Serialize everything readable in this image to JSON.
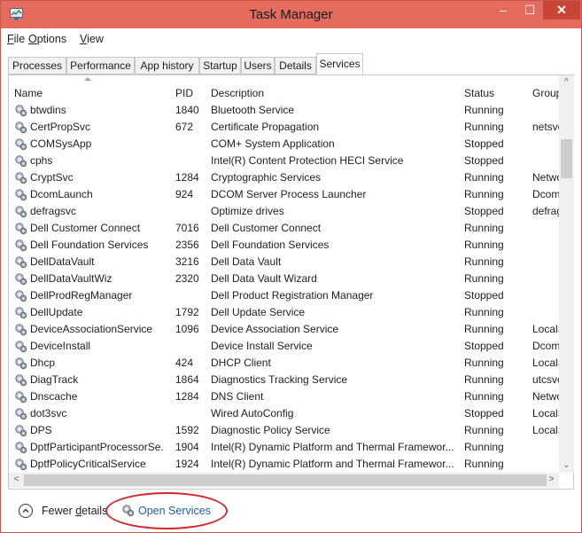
{
  "window": {
    "title": "Task Manager",
    "min_glyph": "–",
    "max_glyph": "☐",
    "close_glyph": "✕"
  },
  "menu": [
    {
      "hotkey": "F",
      "rest": "ile"
    },
    {
      "hotkey": "O",
      "rest": "ptions"
    },
    {
      "hotkey": "V",
      "rest": "iew"
    }
  ],
  "tabs": [
    "Processes",
    "Performance",
    "App history",
    "Startup",
    "Users",
    "Details",
    "Services"
  ],
  "active_tab": "Services",
  "columns": {
    "name": "Name",
    "pid": "PID",
    "description": "Description",
    "status": "Status",
    "group": "Group"
  },
  "services": [
    {
      "name": "btwdins",
      "pid": "1840",
      "description": "Bluetooth Service",
      "status": "Running",
      "group": ""
    },
    {
      "name": "CertPropSvc",
      "pid": "672",
      "description": "Certificate Propagation",
      "status": "Running",
      "group": "netsvcs"
    },
    {
      "name": "COMSysApp",
      "pid": "",
      "description": "COM+ System Application",
      "status": "Stopped",
      "group": ""
    },
    {
      "name": "cphs",
      "pid": "",
      "description": "Intel(R) Content Protection HECI Service",
      "status": "Stopped",
      "group": ""
    },
    {
      "name": "CryptSvc",
      "pid": "1284",
      "description": "Cryptographic Services",
      "status": "Running",
      "group": "Networl"
    },
    {
      "name": "DcomLaunch",
      "pid": "924",
      "description": "DCOM Server Process Launcher",
      "status": "Running",
      "group": "DcomLa"
    },
    {
      "name": "defragsvc",
      "pid": "",
      "description": "Optimize drives",
      "status": "Stopped",
      "group": "defrags"
    },
    {
      "name": "Dell Customer Connect",
      "pid": "7016",
      "description": "Dell Customer Connect",
      "status": "Running",
      "group": ""
    },
    {
      "name": "Dell Foundation Services",
      "pid": "2356",
      "description": "Dell Foundation Services",
      "status": "Running",
      "group": ""
    },
    {
      "name": "DellDataVault",
      "pid": "3216",
      "description": "Dell Data Vault",
      "status": "Running",
      "group": ""
    },
    {
      "name": "DellDataVaultWiz",
      "pid": "2320",
      "description": "Dell Data Vault Wizard",
      "status": "Running",
      "group": ""
    },
    {
      "name": "DellProdRegManager",
      "pid": "",
      "description": "Dell Product Registration Manager",
      "status": "Stopped",
      "group": ""
    },
    {
      "name": "DellUpdate",
      "pid": "1792",
      "description": "Dell Update Service",
      "status": "Running",
      "group": ""
    },
    {
      "name": "DeviceAssociationService",
      "pid": "1096",
      "description": "Device Association Service",
      "status": "Running",
      "group": "LocalSy:"
    },
    {
      "name": "DeviceInstall",
      "pid": "",
      "description": "Device Install Service",
      "status": "Stopped",
      "group": "DcomLa"
    },
    {
      "name": "Dhcp",
      "pid": "424",
      "description": "DHCP Client",
      "status": "Running",
      "group": "LocalSe"
    },
    {
      "name": "DiagTrack",
      "pid": "1864",
      "description": "Diagnostics Tracking Service",
      "status": "Running",
      "group": "utcsvc"
    },
    {
      "name": "Dnscache",
      "pid": "1284",
      "description": "DNS Client",
      "status": "Running",
      "group": "Networl"
    },
    {
      "name": "dot3svc",
      "pid": "",
      "description": "Wired AutoConfig",
      "status": "Stopped",
      "group": "LocalSy:"
    },
    {
      "name": "DPS",
      "pid": "1592",
      "description": "Diagnostic Policy Service",
      "status": "Running",
      "group": "LocalSe"
    },
    {
      "name": "DptfParticipantProcessorSe...",
      "pid": "1904",
      "description": "Intel(R) Dynamic Platform and Thermal Framewor...",
      "status": "Running",
      "group": ""
    },
    {
      "name": "DptfPolicyCriticalService",
      "pid": "1924",
      "description": "Intel(R) Dynamic Platform and Thermal Framewor...",
      "status": "Running",
      "group": ""
    }
  ],
  "scroll": {
    "up": "^",
    "down": "⌄",
    "left": "<",
    "right": ">"
  },
  "footer": {
    "fewer_details_hotkey": "d",
    "fewer_details_pre": "Fewer ",
    "fewer_details_post": "etails",
    "open_services": "Open Services"
  },
  "colors": {
    "titlebar": "#e36c5f",
    "close_button": "#c84537",
    "link": "#1a5fb4",
    "highlight_ellipse": "#d6282a"
  }
}
